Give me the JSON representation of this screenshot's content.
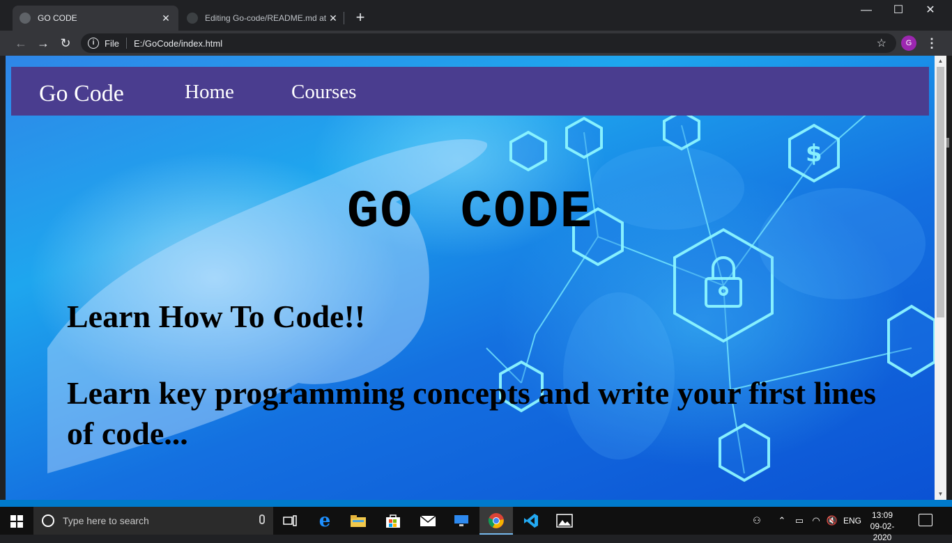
{
  "browser": {
    "tabs": [
      {
        "title": "GO CODE",
        "active": true
      },
      {
        "title": "Editing Go-code/README.md at",
        "active": false
      }
    ],
    "new_tab_label": "+",
    "window_controls": {
      "minimize": "—",
      "maximize": "☐",
      "close": "✕"
    },
    "address": {
      "scheme_label": "File",
      "url": "E:/GoCode/index.html"
    },
    "profile_initial": "G"
  },
  "site": {
    "brand": "Go Code",
    "nav": [
      "Home",
      "Courses"
    ],
    "hero_title": "GO CODE",
    "tagline": "Learn How To Code!!",
    "subtitle": "Learn key programming concepts and write your first lines of code..."
  },
  "taskbar": {
    "search_placeholder": "Type here to search",
    "apps": [
      "task-view",
      "edge",
      "file-explorer",
      "store",
      "mail",
      "remote-desktop",
      "chrome",
      "vscode",
      "photos"
    ],
    "active_app": "chrome",
    "language": "ENG",
    "time": "13:09",
    "date": "09-02-2020"
  },
  "colors": {
    "navbar": "#4a3d8f",
    "chrome_dark": "#202124",
    "vscode_blue": "#007acc"
  }
}
